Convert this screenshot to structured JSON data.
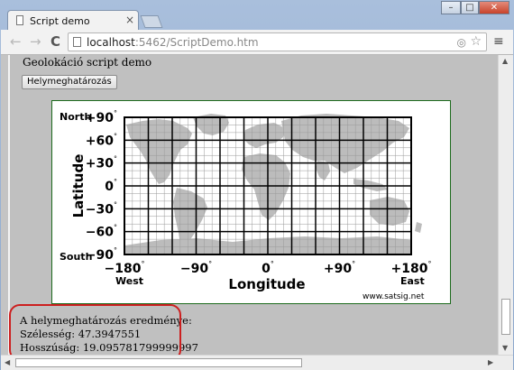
{
  "browser": {
    "tab_title": "Script demo",
    "tab_close": "×",
    "url_host": "localhost",
    "url_path": ":5462/ScriptDemo.htm",
    "window_buttons": [
      "–",
      "□",
      "✕"
    ],
    "nav_icons": [
      "back-icon",
      "forward-icon",
      "reload-icon"
    ],
    "back": "←",
    "forward": "→",
    "reload": "C",
    "menu": "≡",
    "location_icon": "◎",
    "star": "☆"
  },
  "page": {
    "heading": "Geolokáció script demo",
    "locate_button": "Helymeghatározás",
    "map": {
      "lat_ticks": [
        "+90",
        "+60",
        "+30",
        "0",
        "−30",
        "−60",
        "−90"
      ],
      "lon_ticks": [
        "−180",
        "−90",
        "0",
        "+90",
        "+180"
      ],
      "deg": "°",
      "north": "North",
      "south": "South",
      "west": "West",
      "east": "East",
      "ylabel": "Latitude",
      "xlabel": "Longitude",
      "credit": "www.satsig.net"
    },
    "results": {
      "title": "A helymeghatározás eredménye:",
      "latitude": "Szélesség: 47.3947551",
      "longitude": "Hosszúság: 19.095781799999997"
    }
  },
  "colors": {
    "highlight": "#cc1f1f",
    "map_border": "#1d6b1d",
    "land": "#bcbcbc",
    "grid": "#000000"
  }
}
